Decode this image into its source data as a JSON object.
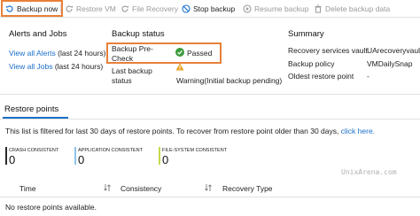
{
  "toolbar": {
    "backup_now": "Backup now",
    "restore_vm": "Restore VM",
    "file_recovery": "File Recovery",
    "stop_backup": "Stop backup",
    "resume_backup": "Resume backup",
    "delete_backup_data": "Delete backup data"
  },
  "alerts": {
    "title": "Alerts and Jobs",
    "view_all_alerts": "View all Alerts",
    "alerts_period": "(last 24 hours)",
    "view_all_jobs": "View all Jobs",
    "jobs_period": "(last 24 hours)"
  },
  "backup_status": {
    "title": "Backup status",
    "precheck_label_1": "Backup Pre-",
    "precheck_label_2": "Check",
    "precheck_value": "Passed",
    "last_backup_label_1": "Last backup",
    "last_backup_label_2": "status",
    "last_backup_value": "Warning(Initial backup pending)"
  },
  "summary": {
    "title": "Summary",
    "vault_label": "Recovery services vault",
    "vault_value": "UArecoveryvault",
    "policy_label": "Backup policy",
    "policy_value": "VMDailySnap",
    "oldest_label": "Oldest restore point",
    "oldest_value": "-"
  },
  "restore_points": {
    "tab_label": "Restore points",
    "filter_text": "This list is filtered for last 30 days of restore points. To recover from restore point older than 30 days,",
    "filter_link": "click here.",
    "counters": [
      {
        "label": "CRASH CONSISTENT",
        "value": "0",
        "color": "#2b2b2b"
      },
      {
        "label": "APPLICATION CONSISTENT",
        "value": "0",
        "color": "#8fc4e8"
      },
      {
        "label": "FILE-SYSTEM CONSISTENT",
        "value": "0",
        "color": "#c9d94a"
      }
    ],
    "columns": {
      "time": "Time",
      "consistency": "Consistency",
      "recovery_type": "Recovery Type"
    },
    "empty_message": "No restore points available."
  },
  "watermark": "UnixArena.com",
  "colors": {
    "accent": "#1a6fc9",
    "highlight": "#e8803a",
    "success": "#3a9b3a",
    "warning": "#e8a020"
  }
}
